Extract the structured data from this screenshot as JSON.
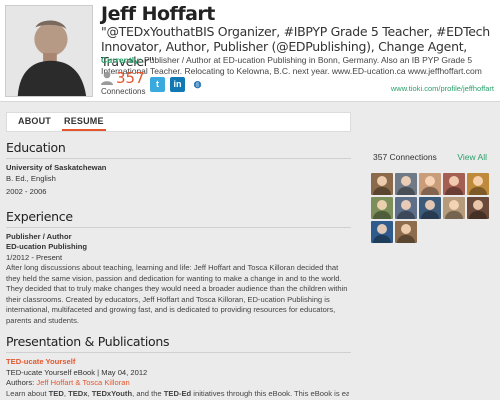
{
  "profile": {
    "name": "Jeff Hoffart",
    "tagline": "\"@TEDxYouthatBIS Organizer, #IBPYP Grade 5 Teacher, #EDTech Innovator, Author, Publisher (@EDPublishing), Change Agent, Traveler\"",
    "currently_label": "Currently:",
    "currently_text": " Publisher / Author at ED-ucation Publishing in Bonn, Germany. Also an IB PYP Grade 5 International Teacher. Relocating to Kelowna, B.C. next year. www.ED-ucation.ca www.jeffhoffart.com",
    "connections_count": "357",
    "connections_label": "Connections",
    "profile_url": "www.tioki.com/profile/jeffhoffart"
  },
  "social": {
    "twitter_glyph": "t",
    "linkedin_glyph": "in",
    "web_glyph": "◍"
  },
  "tabs": [
    {
      "label": "ABOUT"
    },
    {
      "label": "RESUME"
    }
  ],
  "education": {
    "title": "Education",
    "school": "University of Saskatchewan",
    "degree": "B. Ed., English",
    "dates": "2002 - 2006"
  },
  "experience": {
    "title": "Experience",
    "role": "Publisher / Author",
    "org": "ED-ucation Publishing",
    "dates": "1/2012 - Present",
    "description": "After long discussions about teaching, learning and life: Jeff Hoffart and Tosca Killoran decided that they held the same vision, passion and dedication for wanting to make a change in and to the world. They decided that to truly make changes they would need a broader audience than the children within their classrooms. Created by educators, Jeff Hoffart and Tosca Killoran, ED-ucation Publishing is international, multifaceted and growing fast, and is dedicated to providing resources for educators, parents and students."
  },
  "publications": {
    "title": "Presentation & Publications",
    "item_title": "TED-ucate Yourself",
    "item_meta": "TED-ucate Yourself eBook | May 04, 2012",
    "authors_label": "Authors: ",
    "authors": "Jeff Hoffart & Tosca Killoran",
    "learn_prefix": "Learn about ",
    "learn_terms": [
      "TED",
      "TEDx",
      "TEDxYouth",
      "TED-Ed"
    ],
    "learn_sep1": ", ",
    "learn_sep2": ", ",
    "learn_sep3": ", and the ",
    "learn_suffix": " initiatives through this eBook. This eBook is easy"
  },
  "sidebar": {
    "connections_heading": "357 Connections",
    "view_all": "View All",
    "thumb_colors": [
      "#8a6a4a",
      "#6f7a86",
      "#c99c7a",
      "#a45e52",
      "#c08a3c",
      "#7c8f5a",
      "#5e6f8a",
      "#3c5a7a",
      "#b59a7c",
      "#6a4a3a",
      "#2f5c8c",
      "#8c6c4c"
    ]
  }
}
